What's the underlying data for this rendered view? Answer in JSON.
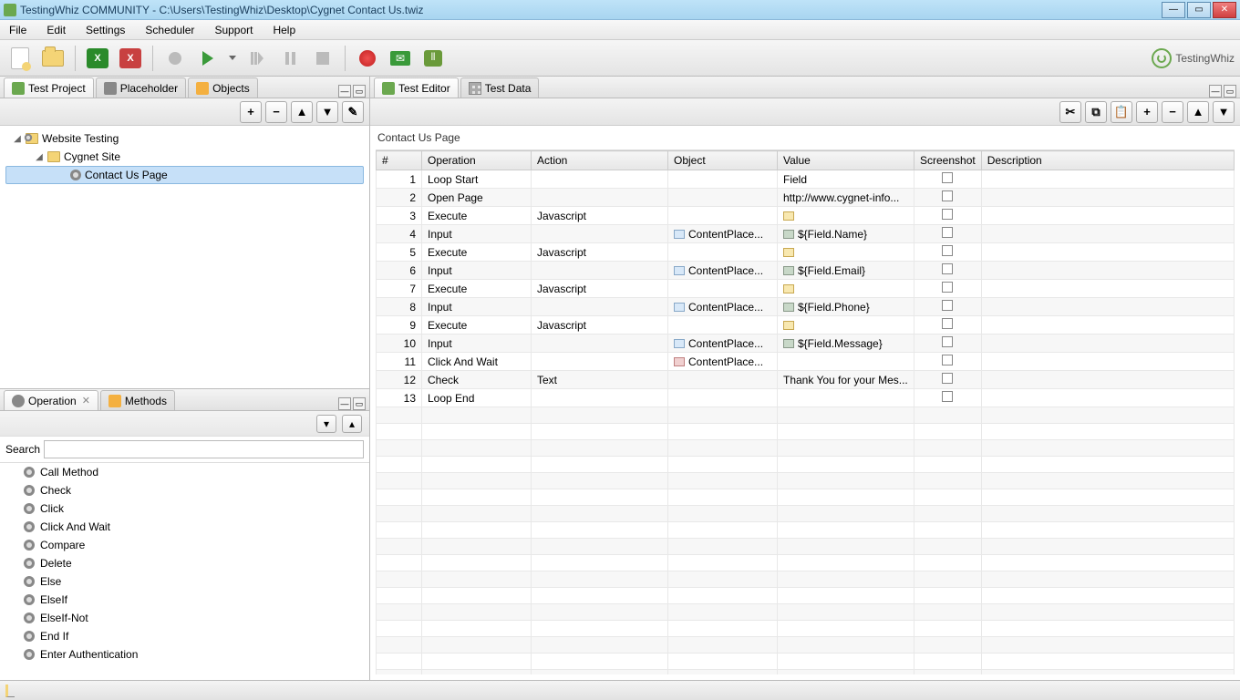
{
  "window": {
    "title": "TestingWhiz COMMUNITY - C:\\Users\\TestingWhiz\\Desktop\\Cygnet Contact Us.twiz"
  },
  "menu": [
    "File",
    "Edit",
    "Settings",
    "Scheduler",
    "Support",
    "Help"
  ],
  "brand": "TestingWhiz",
  "left_tabs": [
    "Test Project",
    "Placeholder",
    "Objects"
  ],
  "tree": {
    "root": "Website Testing",
    "child": "Cygnet Site",
    "leaf": "Contact Us Page"
  },
  "lower_left_tabs": [
    "Operation",
    "Methods"
  ],
  "search_label": "Search",
  "operations": [
    "Call Method",
    "Check",
    "Click",
    "Click And Wait",
    "Compare",
    "Delete",
    "Else",
    "ElseIf",
    "ElseIf-Not",
    "End If",
    "Enter Authentication"
  ],
  "right_tabs": [
    "Test Editor",
    "Test Data"
  ],
  "editor_title": "Contact Us Page",
  "columns": [
    "#",
    "Operation",
    "Action",
    "Object",
    "Value",
    "Screenshot",
    "Description"
  ],
  "rows": [
    {
      "n": 1,
      "op": "Loop Start",
      "act": "",
      "obj": "",
      "val": "Field",
      "oi": "",
      "vi": ""
    },
    {
      "n": 2,
      "op": "Open Page",
      "act": "",
      "obj": "",
      "val": "http://www.cygnet-info...",
      "oi": "",
      "vi": ""
    },
    {
      "n": 3,
      "op": "Execute",
      "act": "Javascript",
      "obj": "",
      "val": "",
      "oi": "",
      "vi": "edit"
    },
    {
      "n": 4,
      "op": "Input",
      "act": "",
      "obj": "ContentPlace...",
      "val": "${Field.Name}",
      "oi": "text",
      "vi": "db"
    },
    {
      "n": 5,
      "op": "Execute",
      "act": "Javascript",
      "obj": "",
      "val": "",
      "oi": "",
      "vi": "edit"
    },
    {
      "n": 6,
      "op": "Input",
      "act": "",
      "obj": "ContentPlace...",
      "val": "${Field.Email}",
      "oi": "text",
      "vi": "db"
    },
    {
      "n": 7,
      "op": "Execute",
      "act": "Javascript",
      "obj": "",
      "val": "",
      "oi": "",
      "vi": "edit"
    },
    {
      "n": 8,
      "op": "Input",
      "act": "",
      "obj": "ContentPlace...",
      "val": "${Field.Phone}",
      "oi": "text",
      "vi": "db"
    },
    {
      "n": 9,
      "op": "Execute",
      "act": "Javascript",
      "obj": "",
      "val": "",
      "oi": "",
      "vi": "edit"
    },
    {
      "n": 10,
      "op": "Input",
      "act": "",
      "obj": "ContentPlace...",
      "val": "${Field.Message}",
      "oi": "text",
      "vi": "db"
    },
    {
      "n": 11,
      "op": "Click And Wait",
      "act": "",
      "obj": "ContentPlace...",
      "val": "",
      "oi": "link",
      "vi": ""
    },
    {
      "n": 12,
      "op": "Check",
      "act": "Text",
      "obj": "",
      "val": "Thank You for your Mes...",
      "oi": "",
      "vi": ""
    },
    {
      "n": 13,
      "op": "Loop End",
      "act": "",
      "obj": "",
      "val": "",
      "oi": "",
      "vi": ""
    }
  ]
}
